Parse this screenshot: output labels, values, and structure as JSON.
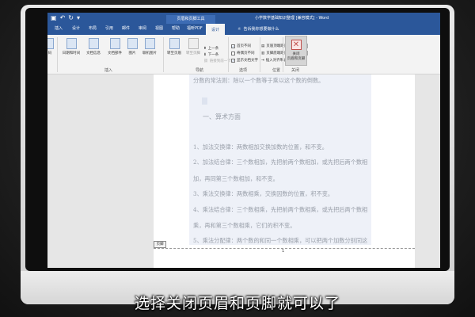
{
  "window": {
    "qat_icons": [
      "save-icon",
      "undo-icon",
      "redo-icon",
      "customize-qat-icon"
    ],
    "contextual_tab_title": "页眉和页脚工具",
    "doc_title": "小学数学基础知识整理 [兼容模式] - Word"
  },
  "tabs": [
    {
      "label": "插入"
    },
    {
      "label": "设计"
    },
    {
      "label": "布局"
    },
    {
      "label": "引用"
    },
    {
      "label": "邮件"
    },
    {
      "label": "审阅"
    },
    {
      "label": "视图"
    },
    {
      "label": "帮助"
    },
    {
      "label": "福昕PDF"
    },
    {
      "label": "设计"
    }
  ],
  "tell_me": "告诉我你想要做什么",
  "ribbon": {
    "insert_group": {
      "buttons": [
        "日期和时间",
        "文档信息",
        "文档部件",
        "图片",
        "联机图片"
      ],
      "label": "插入",
      "cut_label": "码"
    },
    "nav_group": {
      "big_buttons": [
        "转至页眉",
        "转至页脚"
      ],
      "small_items": [
        "上一条",
        "下一条",
        "链接到前一节"
      ],
      "label": "导航"
    },
    "options_group": {
      "items": [
        {
          "label": "首页不同",
          "checked": true
        },
        {
          "label": "奇偶页不同",
          "checked": false
        },
        {
          "label": "显示文档文字",
          "checked": true
        }
      ],
      "label": "选项"
    },
    "position_group": {
      "header_top_label": "页眉顶端距离:",
      "header_top_value": "1.5 厘米",
      "footer_bottom_label": "页脚底端距离:",
      "footer_bottom_value": "1.75 厘米",
      "align_tab_label": "插入对齐制表位",
      "label": "位置"
    },
    "close_group": {
      "button_label_1": "关闭",
      "button_label_2": "页眉和页脚",
      "label": "关闭"
    }
  },
  "document": {
    "lines": [
      "分数的常法则：除以一个数等于乘以这个数的倒数。",
      "一、算术方面",
      "1、加法交换律：两数相加交换加数的位置，和不变。",
      "2、加法结合律：三个数相加，先把前两个数相加，或先把后两个数相",
      "加，再同第三个数相加，和不变。",
      "3、乘法交换律：两数相乘，交换因数的位置，积不变。",
      "4、乘法结合律：三个数相乘，先把前两个数相乘，或先把后两个数相",
      "乘，再和第三个数相乘，它们的积不变。",
      "5、乘法分配律：两个数的和同一个数相乘，可以把两个加数分别同这"
    ],
    "footer_tag": "页脚",
    "page_number": "1"
  },
  "subtitle": "选择关闭页眉和页脚就可以了"
}
